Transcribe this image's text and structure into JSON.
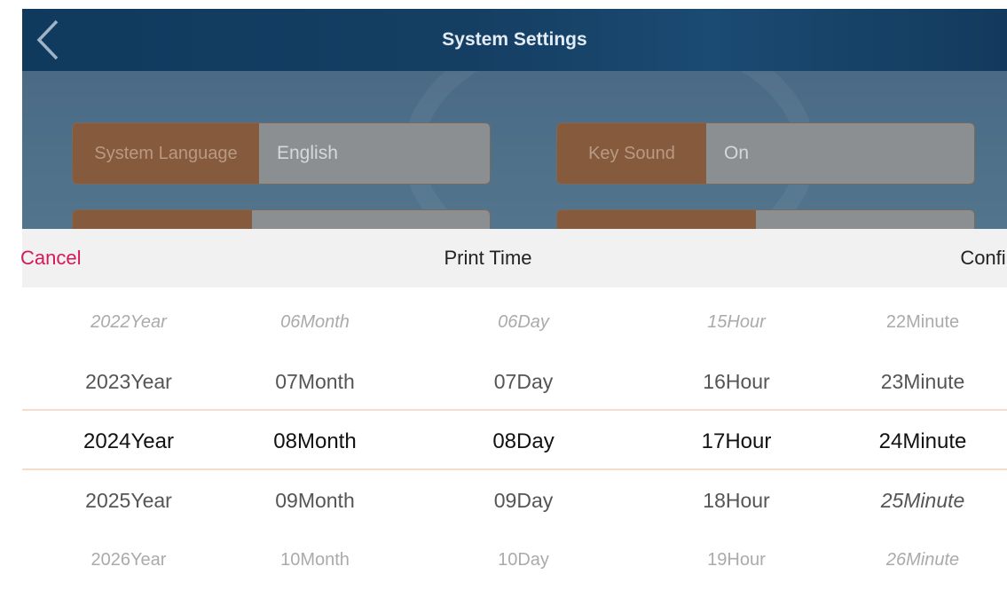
{
  "header": {
    "title": "System Settings",
    "back_icon": "chevron-left-icon"
  },
  "settings": [
    {
      "label": "System Language",
      "value": "English"
    },
    {
      "label": "Key Sound",
      "value": "On"
    }
  ],
  "picker": {
    "cancel_label": "Cancel",
    "title": "Print Time",
    "confirm_label": "Confir",
    "selected_line_color": "#f7dccb",
    "cancel_color": "#d6185a",
    "columns": [
      {
        "name": "year",
        "items": [
          "2022Year",
          "2023Year",
          "2024Year",
          "2025Year",
          "2026Year"
        ]
      },
      {
        "name": "month",
        "items": [
          "06Month",
          "07Month",
          "08Month",
          "09Month",
          "10Month"
        ]
      },
      {
        "name": "day",
        "items": [
          "06Day",
          "07Day",
          "08Day",
          "09Day",
          "10Day"
        ]
      },
      {
        "name": "hour",
        "items": [
          "15Hour",
          "16Hour",
          "17Hour",
          "18Hour",
          "19Hour"
        ]
      },
      {
        "name": "minute",
        "items": [
          "22Minute",
          "23Minute",
          "24Minute",
          "25Minute",
          "26Minute"
        ]
      }
    ]
  }
}
